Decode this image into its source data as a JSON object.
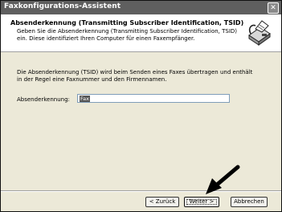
{
  "window": {
    "title": "Faxkonfigurations-Assistent",
    "close_glyph": "✕"
  },
  "header": {
    "title": "Absenderkennung (Transmitting Subscriber Identification, TSID)",
    "description": "Geben Sie die Absenderkennung (Transmitting Subscriber Identification, TSID) ein. Diese identifiziert Ihren Computer für einen Faxempfänger.",
    "icon": "fax-machine-icon"
  },
  "content": {
    "info": "Die Absenderkennung (TSID) wird beim Senden eines Faxes übertragen und enthält in der Regel eine Faxnummer und den Firmennamen.",
    "field_label": "Absenderkennung:",
    "field_value": "Fax"
  },
  "buttons": {
    "back": "< Zurück",
    "next": "Weiter >",
    "cancel": "Abbrechen"
  },
  "annotation": {
    "icon": "pointer-arrow-icon"
  }
}
